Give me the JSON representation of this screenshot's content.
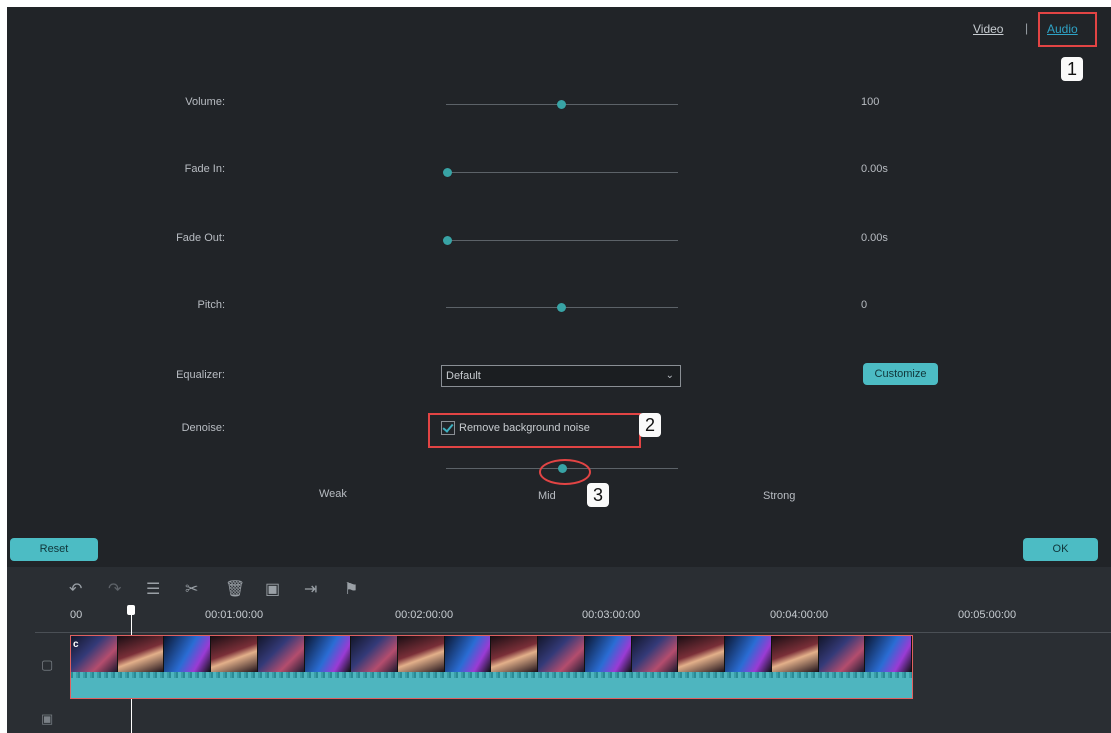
{
  "tabs": {
    "video": "Video",
    "separator": "|",
    "audio": "Audio"
  },
  "badges": {
    "one": "1",
    "two": "2",
    "three": "3"
  },
  "volume": {
    "label": "Volume:",
    "value": "100",
    "level": 0.5
  },
  "fade_in": {
    "label": "Fade In:",
    "value": "0.00s",
    "level": 0.0
  },
  "fade_out": {
    "label": "Fade Out:",
    "value": "0.00s",
    "level": 0.0
  },
  "pitch": {
    "label": "Pitch:",
    "value": "0",
    "level": 0.5
  },
  "equalizer": {
    "label": "Equalizer:",
    "selected": "Default",
    "customize": "Customize"
  },
  "denoise": {
    "label": "Denoise:",
    "checkbox_label": "Remove background noise",
    "checked": true,
    "level": 0.5,
    "weak": "Weak",
    "mid": "Mid",
    "strong": "Strong"
  },
  "buttons": {
    "reset": "Reset",
    "ok": "OK"
  },
  "toolbar_icons": [
    "undo-icon",
    "redo-icon",
    "adjust-icon",
    "cut-icon",
    "delete-icon",
    "crop-icon",
    "export-icon",
    "marker-icon"
  ],
  "timeline": {
    "ticks": [
      "00",
      "00:01:00:00",
      "00:02:00:00",
      "00:03:00:00",
      "00:04:00:00",
      "00:05:00:00"
    ],
    "clip_tag": "c"
  },
  "colors": {
    "accent": "#38a3a5",
    "highlight": "#e24444",
    "link": "#2fa3c6"
  }
}
